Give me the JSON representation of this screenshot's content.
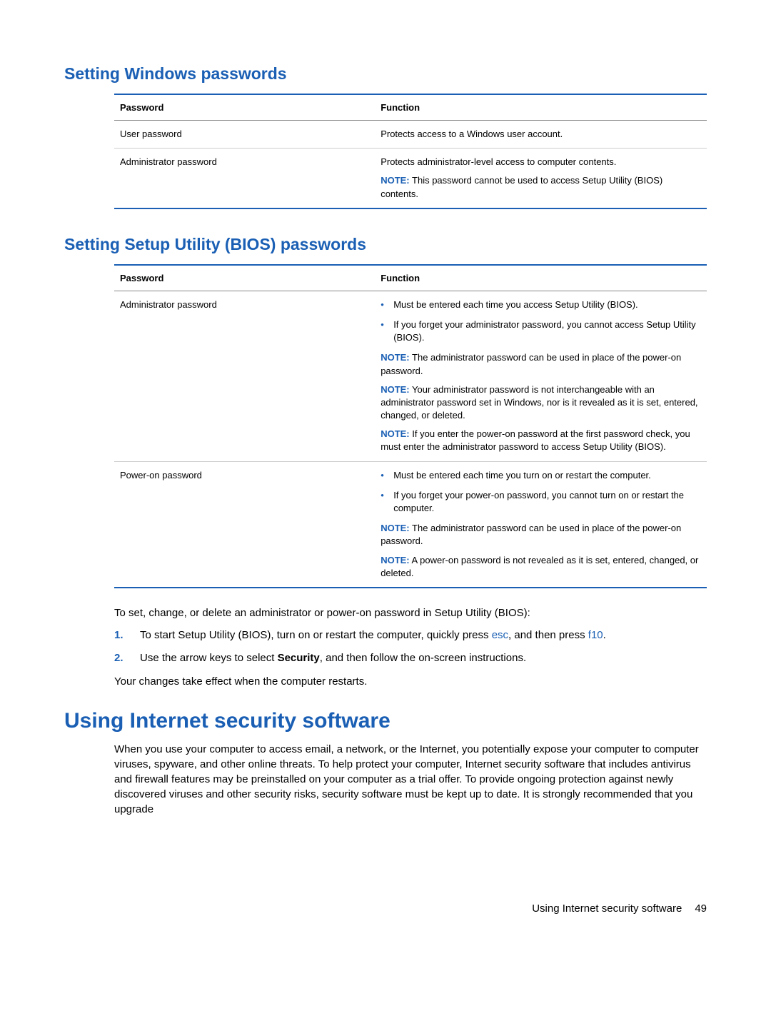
{
  "section1": {
    "heading": "Setting Windows passwords",
    "table": {
      "col1": "Password",
      "col2": "Function",
      "rows": [
        {
          "pw": "User password",
          "fn": "Protects access to a Windows user account."
        },
        {
          "pw": "Administrator password",
          "fn": "Protects administrator-level access to computer contents.",
          "note_label": "NOTE:",
          "note": "This password cannot be used to access Setup Utility (BIOS) contents."
        }
      ]
    }
  },
  "section2": {
    "heading": "Setting Setup Utility (BIOS) passwords",
    "table": {
      "col1": "Password",
      "col2": "Function",
      "rows": [
        {
          "pw": "Administrator password",
          "bullets": [
            "Must be entered each time you access Setup Utility (BIOS).",
            "If you forget your administrator password, you cannot access Setup Utility (BIOS)."
          ],
          "notes": [
            {
              "label": "NOTE:",
              "text": "The administrator password can be used in place of the power-on password."
            },
            {
              "label": "NOTE:",
              "text": "Your administrator password is not interchangeable with an administrator password set in Windows, nor is it revealed as it is set, entered, changed, or deleted."
            },
            {
              "label": "NOTE:",
              "text": "If you enter the power-on password at the first password check, you must enter the administrator password to access Setup Utility (BIOS)."
            }
          ]
        },
        {
          "pw": "Power-on password",
          "bullets": [
            "Must be entered each time you turn on or restart the computer.",
            "If you forget your power-on password, you cannot turn on or restart the computer."
          ],
          "notes": [
            {
              "label": "NOTE:",
              "text": "The administrator password can be used in place of the power-on password."
            },
            {
              "label": "NOTE:",
              "text": "A power-on password is not revealed as it is set, entered, changed, or deleted."
            }
          ]
        }
      ]
    },
    "after_para": "To set, change, or delete an administrator or power-on password in Setup Utility (BIOS):",
    "steps": [
      {
        "num": "1.",
        "pre": "To start Setup Utility (BIOS), turn on or restart the computer, quickly press ",
        "k1": "esc",
        "mid": ", and then press ",
        "k2": "f10",
        "post": "."
      },
      {
        "num": "2.",
        "text_pre": "Use the arrow keys to select ",
        "bold": "Security",
        "text_post": ", and then follow the on-screen instructions."
      }
    ],
    "closing": "Your changes take effect when the computer restarts."
  },
  "section3": {
    "heading": "Using Internet security software",
    "para": "When you use your computer to access email, a network, or the Internet, you potentially expose your computer to computer viruses, spyware, and other online threats. To help protect your computer, Internet security software that includes antivirus and firewall features may be preinstalled on your computer as a trial offer. To provide ongoing protection against newly discovered viruses and other security risks, security software must be kept up to date. It is strongly recommended that you upgrade"
  },
  "footer": {
    "label": "Using Internet security software",
    "page": "49"
  }
}
